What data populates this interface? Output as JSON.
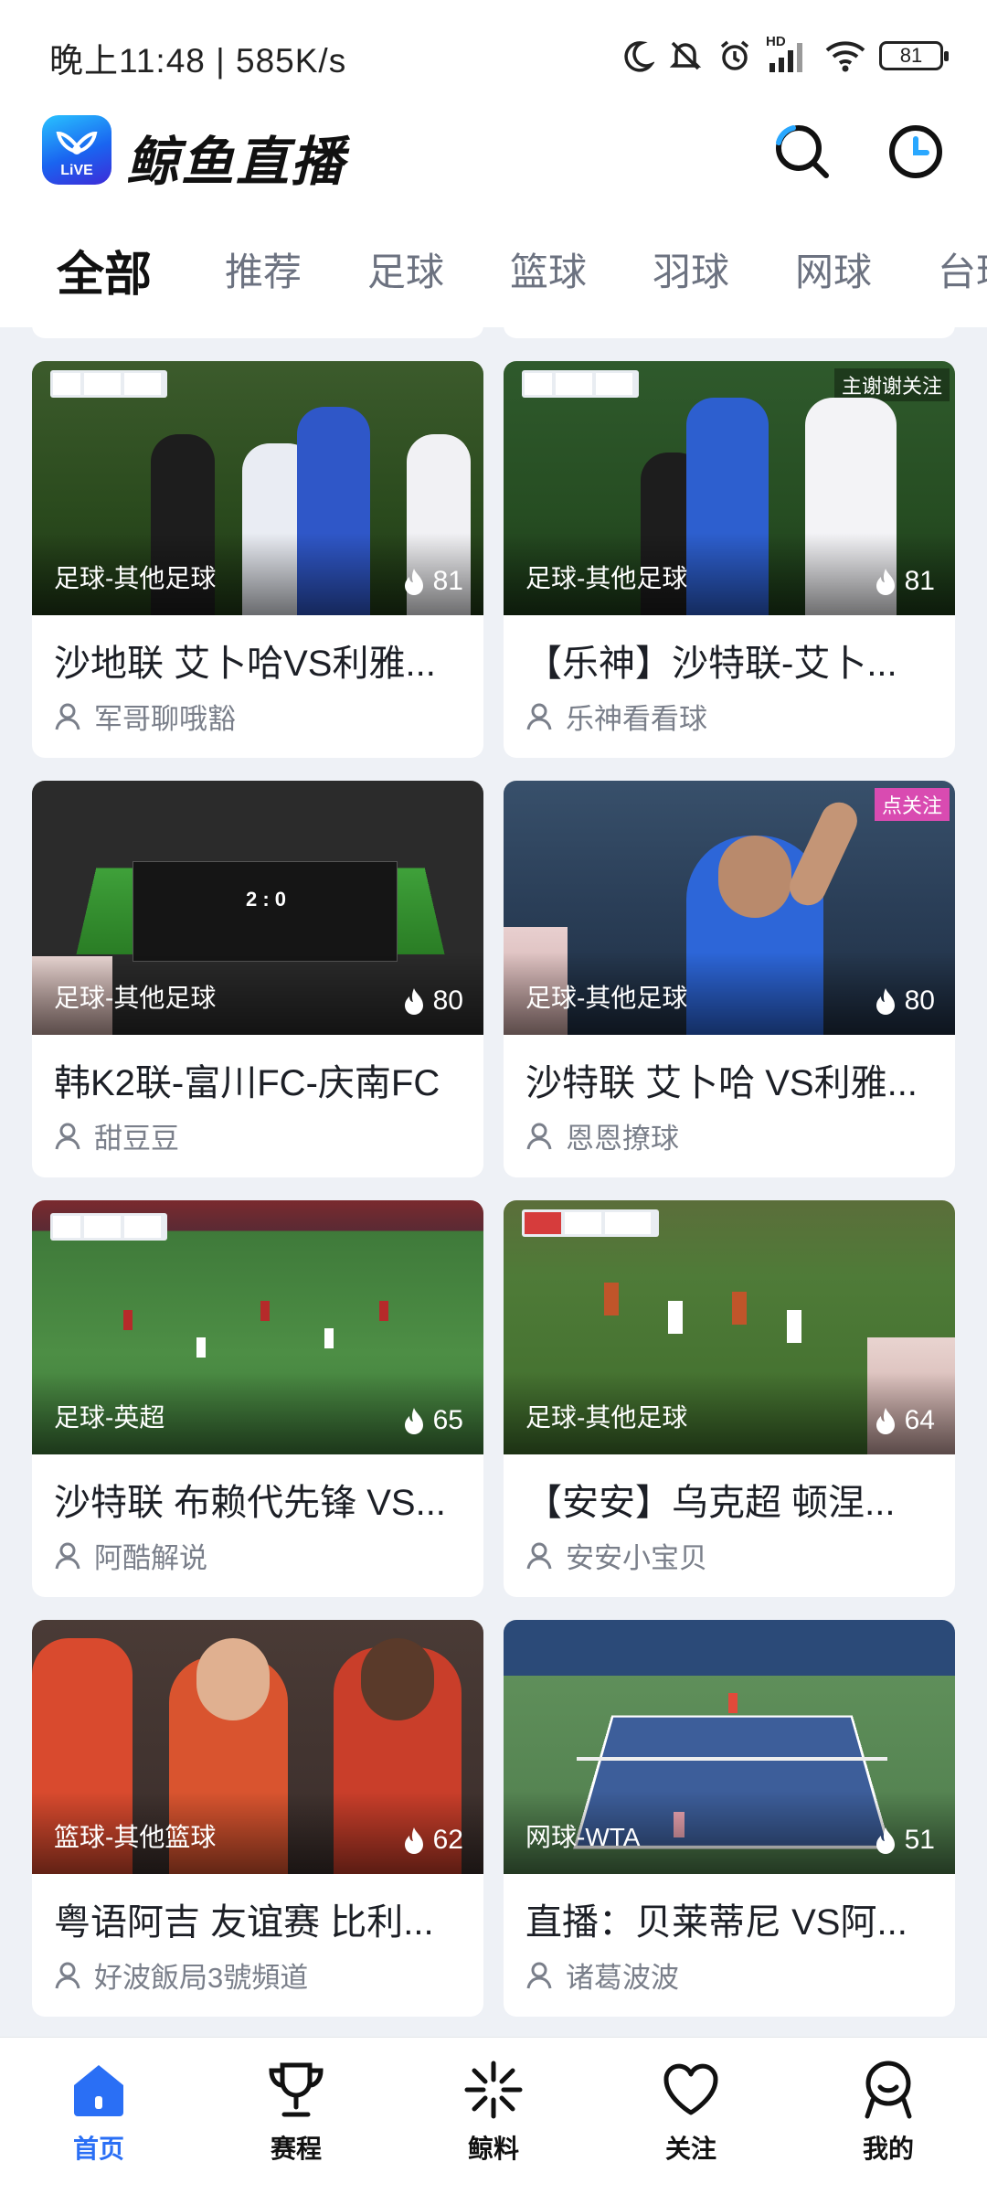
{
  "status_bar": {
    "time_speed": "晚上11:48 | 585K/s",
    "network": "HD",
    "battery": "81"
  },
  "header": {
    "logo_badge": "LiVE",
    "app_name": "鲸鱼直播",
    "search_icon": "search-icon",
    "history_icon": "clock-icon"
  },
  "tabs": [
    "全部",
    "推荐",
    "足球",
    "篮球",
    "羽球",
    "网球",
    "台球"
  ],
  "active_tab": "全部",
  "accent_color": "#2a6ff5",
  "streams": [
    {
      "category": "足球-其他足球",
      "heat": "81",
      "title": "沙地联 艾卜哈VS利雅...",
      "author": "军哥聊哦豁",
      "overlay": "",
      "scene": "soccer-closeup"
    },
    {
      "category": "足球-其他足球",
      "heat": "81",
      "title": "【乐神】沙特联-艾卜...",
      "author": "乐神看看球",
      "overlay": "主谢谢关注",
      "scene": "soccer-closeup"
    },
    {
      "category": "足球-其他足球",
      "heat": "80",
      "title": "韩K2联-富川FC-庆南FC",
      "author": "甜豆豆",
      "overlay": "",
      "scene": "scoreboard",
      "score": "2 : 0"
    },
    {
      "category": "足球-其他足球",
      "heat": "80",
      "title": "沙特联 艾卜哈 VS利雅...",
      "author": "恩恩撩球",
      "overlay": "点关注",
      "scene": "celebration"
    },
    {
      "category": "足球-英超",
      "heat": "65",
      "title": "沙特联 布赖代先锋 VS...",
      "author": "阿酷解说",
      "overlay": "",
      "scene": "pitch-wide"
    },
    {
      "category": "足球-其他足球",
      "heat": "64",
      "title": "【安安】乌克超 顿涅...",
      "author": "安安小宝贝",
      "overlay": "",
      "scene": "pitch-mid"
    },
    {
      "category": "篮球-其他篮球",
      "heat": "62",
      "title": "粤语阿吉  友谊赛 比利...",
      "author": "好波飯局3號頻道",
      "overlay": "",
      "scene": "basketball"
    },
    {
      "category": "网球-WTA",
      "heat": "51",
      "title": "直播：贝莱蒂尼 VS阿...",
      "author": "诸葛波波",
      "overlay": "",
      "scene": "tennis"
    }
  ],
  "bottom_nav": [
    {
      "label": "首页",
      "icon": "home-icon",
      "active": true
    },
    {
      "label": "赛程",
      "icon": "trophy-icon",
      "active": false
    },
    {
      "label": "鲸料",
      "icon": "sparkle-icon",
      "active": false
    },
    {
      "label": "关注",
      "icon": "heart-icon",
      "active": false
    },
    {
      "label": "我的",
      "icon": "profile-icon",
      "active": false
    }
  ]
}
